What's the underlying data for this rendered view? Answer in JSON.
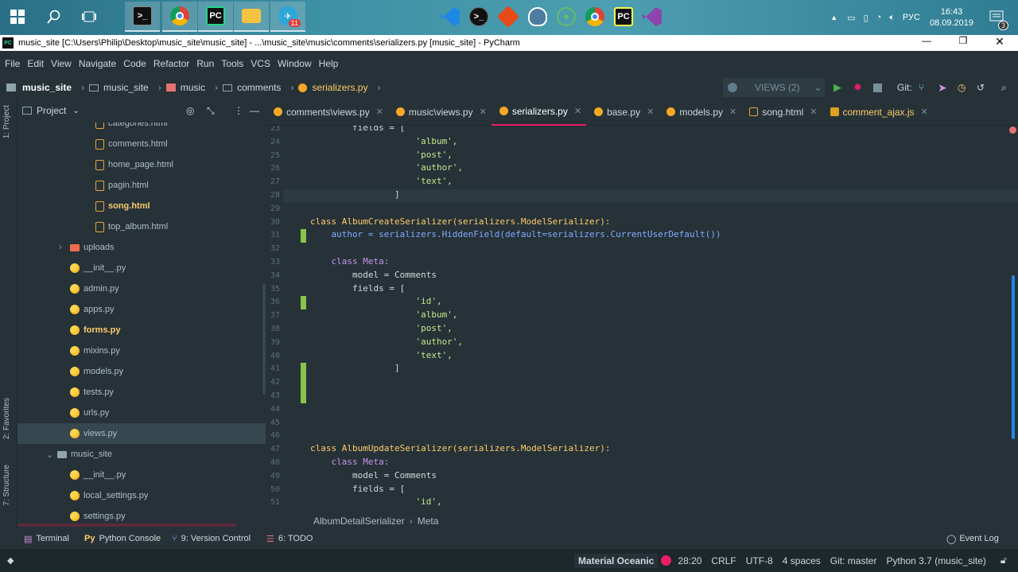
{
  "taskbar": {
    "clock_time": "16:43",
    "clock_date": "08.09.2019",
    "lang": "РУС",
    "notif_count": "3",
    "telegram_badge": "11"
  },
  "window": {
    "title": "music_site [C:\\Users\\Philip\\Desktop\\music_site\\music_site] - ...\\music_site\\music\\comments\\serializers.py [music_site] - PyCharm"
  },
  "menu": [
    "File",
    "Edit",
    "View",
    "Navigate",
    "Code",
    "Refactor",
    "Run",
    "Tools",
    "VCS",
    "Window",
    "Help"
  ],
  "nav": {
    "crumbs": [
      "music_site",
      "music_site",
      "music",
      "comments",
      "serializers.py"
    ],
    "run_config": "VIEWS (2)",
    "git_label": "Git:"
  },
  "side_tabs": {
    "project": "1: Project",
    "favorites": "2: Favorites",
    "structure": "7: Structure"
  },
  "project": {
    "header": "Project",
    "items": [
      {
        "label": "categories.html",
        "type": "html",
        "indent": 2
      },
      {
        "label": "comments.html",
        "type": "html",
        "indent": 2
      },
      {
        "label": "home_page.html",
        "type": "html",
        "indent": 2
      },
      {
        "label": "pagin.html",
        "type": "html",
        "indent": 2
      },
      {
        "label": "song.html",
        "type": "html",
        "indent": 2,
        "bold": true
      },
      {
        "label": "top_album.html",
        "type": "html",
        "indent": 2
      },
      {
        "label": "uploads",
        "type": "dir",
        "indent": 1,
        "arrow": "right"
      },
      {
        "label": "__init__.py",
        "type": "py",
        "indent": 1
      },
      {
        "label": "admin.py",
        "type": "py",
        "indent": 1
      },
      {
        "label": "apps.py",
        "type": "py",
        "indent": 1
      },
      {
        "label": "forms.py",
        "type": "py",
        "indent": 1,
        "bold": true
      },
      {
        "label": "mixins.py",
        "type": "py",
        "indent": 1
      },
      {
        "label": "models.py",
        "type": "py",
        "indent": 1
      },
      {
        "label": "tests.py",
        "type": "py",
        "indent": 1
      },
      {
        "label": "urls.py",
        "type": "py",
        "indent": 1
      },
      {
        "label": "views.py",
        "type": "py",
        "indent": 1,
        "selected": true
      },
      {
        "label": "music_site",
        "type": "dir",
        "indent": 0,
        "arrow": "down"
      },
      {
        "label": "__init__.py",
        "type": "py",
        "indent": 1
      },
      {
        "label": "local_settings.py",
        "type": "py",
        "indent": 1
      },
      {
        "label": "settings.py",
        "type": "py",
        "indent": 1
      }
    ]
  },
  "tabs": [
    {
      "label": "comments\\views.py"
    },
    {
      "label": "music\\views.py"
    },
    {
      "label": "serializers.py",
      "active": true
    },
    {
      "label": "base.py"
    },
    {
      "label": "models.py"
    },
    {
      "label": "song.html"
    },
    {
      "label": "comment_ajax.js"
    }
  ],
  "code": [
    {
      "n": "23",
      "t": "        fields = ["
    },
    {
      "n": "24",
      "t": "                    'album',"
    },
    {
      "n": "25",
      "t": "                    'post',"
    },
    {
      "n": "26",
      "t": "                    'author',"
    },
    {
      "n": "27",
      "t": "                    'text',"
    },
    {
      "n": "28",
      "t": "                ]"
    },
    {
      "n": "29",
      "t": ""
    },
    {
      "n": "30",
      "t": "class AlbumCreateSerializer(serializers.ModelSerializer):"
    },
    {
      "n": "31",
      "t": "    author = serializers.HiddenField(default=serializers.CurrentUserDefault())"
    },
    {
      "n": "32",
      "t": ""
    },
    {
      "n": "33",
      "t": "    class Meta:"
    },
    {
      "n": "34",
      "t": "        model = Comments"
    },
    {
      "n": "35",
      "t": "        fields = ["
    },
    {
      "n": "36",
      "t": "                    'id',"
    },
    {
      "n": "37",
      "t": "                    'album',"
    },
    {
      "n": "38",
      "t": "                    'post',"
    },
    {
      "n": "39",
      "t": "                    'author',"
    },
    {
      "n": "40",
      "t": "                    'text',"
    },
    {
      "n": "41",
      "t": "                ]"
    },
    {
      "n": "42",
      "t": ""
    },
    {
      "n": "43",
      "t": ""
    },
    {
      "n": "44",
      "t": ""
    },
    {
      "n": "45",
      "t": ""
    },
    {
      "n": "46",
      "t": ""
    },
    {
      "n": "47",
      "t": "class AlbumUpdateSerializer(serializers.ModelSerializer):"
    },
    {
      "n": "48",
      "t": "    class Meta:"
    },
    {
      "n": "49",
      "t": "        model = Comments"
    },
    {
      "n": "50",
      "t": "        fields = ["
    },
    {
      "n": "51",
      "t": "                    'id',"
    }
  ],
  "breadcrumb": {
    "a": "AlbumDetailSerializer",
    "b": "Meta"
  },
  "tool_windows": [
    "Terminal",
    "Python Console",
    "9: Version Control",
    "6: TODO"
  ],
  "event_log": "Event Log",
  "status": {
    "theme": "Material Oceanic",
    "position": "28:20",
    "line_sep": "CRLF",
    "encoding": "UTF-8",
    "indent": "4 spaces",
    "git": "Git: master",
    "interpreter": "Python 3.7 (music_site)"
  }
}
